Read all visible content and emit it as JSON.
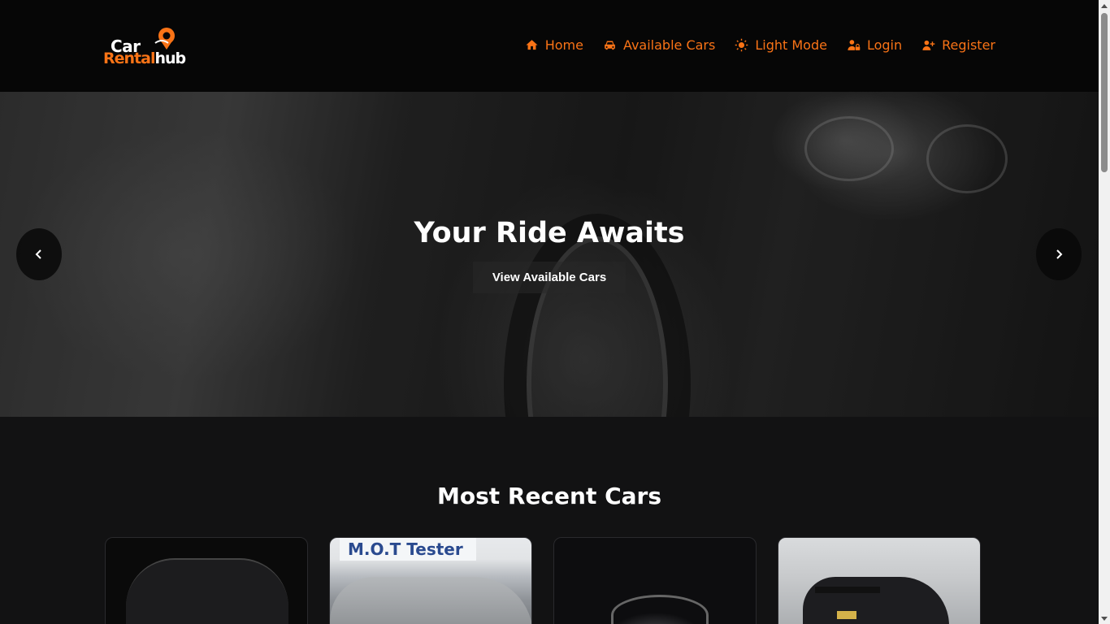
{
  "brand": {
    "logo_top": "Car",
    "logo_bottom_a": "Rental",
    "logo_bottom_b": "hub",
    "accent_color": "#f97316"
  },
  "nav": {
    "items": [
      {
        "label": "Home",
        "icon": "home-icon"
      },
      {
        "label": "Available Cars",
        "icon": "car-icon"
      },
      {
        "label": "Light Mode",
        "icon": "sun-icon"
      },
      {
        "label": "Login",
        "icon": "user-lock-icon"
      },
      {
        "label": "Register",
        "icon": "user-plus-icon"
      }
    ]
  },
  "hero": {
    "title": "Your Ride Awaits",
    "button_label": "View Available Cars",
    "prev_icon": "chevron-left-icon",
    "next_icon": "chevron-right-icon"
  },
  "recent": {
    "title": "Most Recent Cars",
    "card_2_sign": "M.O.T Tester"
  }
}
